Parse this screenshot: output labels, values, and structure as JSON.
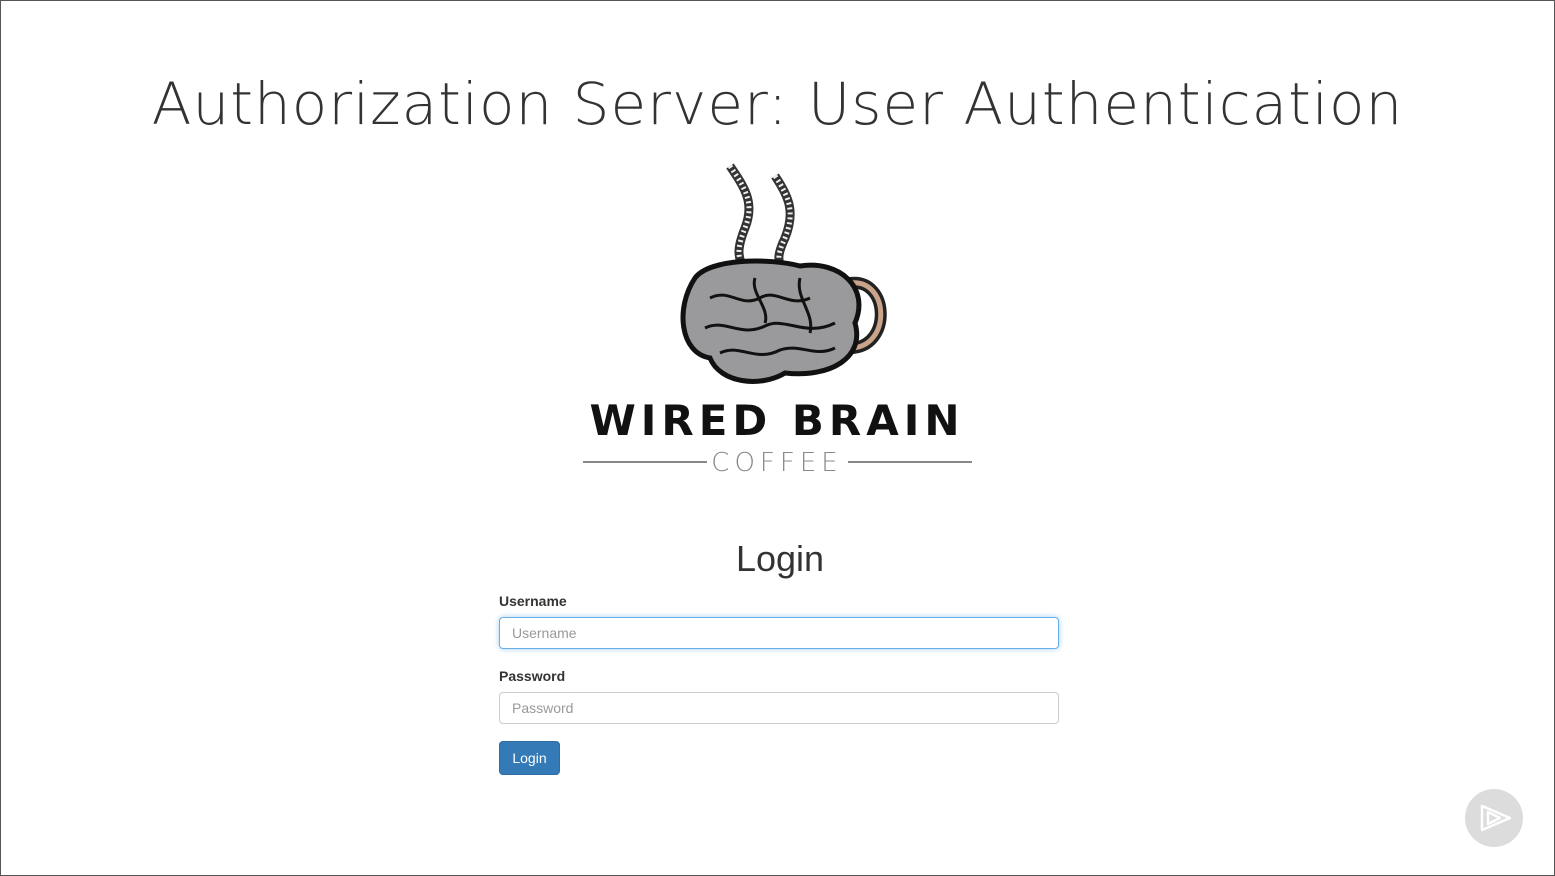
{
  "slide": {
    "title": "Authorization Server: User Authentication"
  },
  "logo": {
    "line1": "WIRED BRAIN",
    "line2": "COFFEE"
  },
  "form": {
    "heading": "Login",
    "username_label": "Username",
    "username_placeholder": "Username",
    "password_label": "Password",
    "password_placeholder": "Password",
    "submit_label": "Login"
  },
  "colors": {
    "primary": "#337ab7",
    "focus": "#66afe9"
  },
  "icons": {
    "player": "play-logo-icon"
  }
}
